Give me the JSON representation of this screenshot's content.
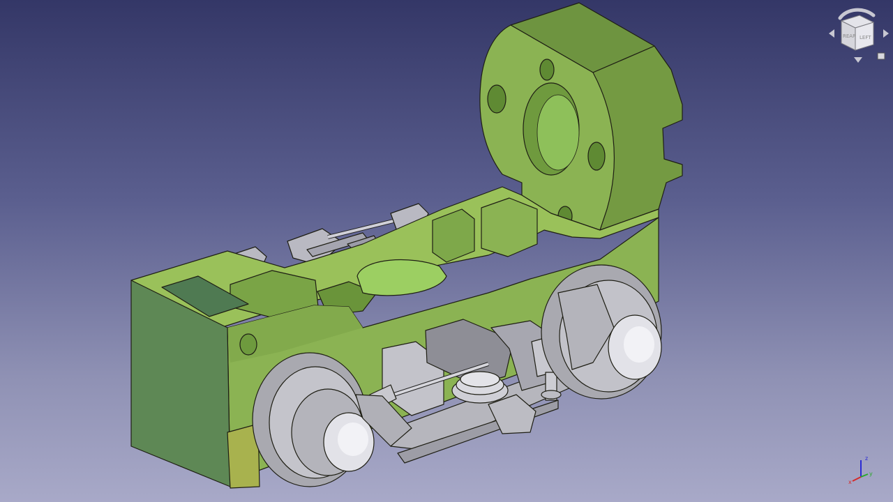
{
  "navigation_cube": {
    "face_rear": "REAR",
    "face_left": "LEFT"
  },
  "axis_indicator": {
    "x_label": "x",
    "y_label": "y",
    "z_label": "z",
    "x_color": "#d42a2a",
    "y_color": "#2aa82a",
    "z_color": "#2a2ad4"
  },
  "colors": {
    "background_top": "#343767",
    "background_bottom": "#a8a9c8",
    "part_green": "#8bb353",
    "part_gray": "#b9b9bf"
  }
}
